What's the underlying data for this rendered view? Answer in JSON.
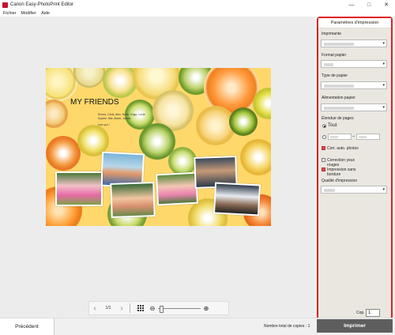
{
  "window": {
    "title": "Canon Easy-PhotoPrint Editor"
  },
  "menu": [
    "Fichier",
    "Modifier",
    "Aide"
  ],
  "card": {
    "title": "MY FRIENDS",
    "line1": "Emma, Chris, Alex, Noah, Hugo, Lucie",
    "line2": "Sophie, Mia, Marie, James",
    "line3": "love you !"
  },
  "nav": {
    "page": "1/1"
  },
  "panel": {
    "header": "Paramètres d'impression",
    "printer_label": "Imprimante",
    "paper_size_label": "Format papier",
    "paper_type_label": "Type de papier",
    "paper_source_label": "Alimentation papier",
    "page_range_label": "Étendue de pages",
    "all_label": "Tout",
    "range_sep": "–",
    "auto_correct_label": "Corr. auto. photos",
    "red_eye_label_1": "Correction yeux",
    "red_eye_label_2": "rouges",
    "borderless_label_1": "Impression sans",
    "borderless_label_2": "bordure",
    "quality_label": "Qualité d'impression",
    "copies_label": "Cop.",
    "copies_value": "1"
  },
  "footer": {
    "prev_label": "Précédent",
    "total_copies": "Nombre total de copies : 1",
    "print_label": "Imprimer"
  }
}
